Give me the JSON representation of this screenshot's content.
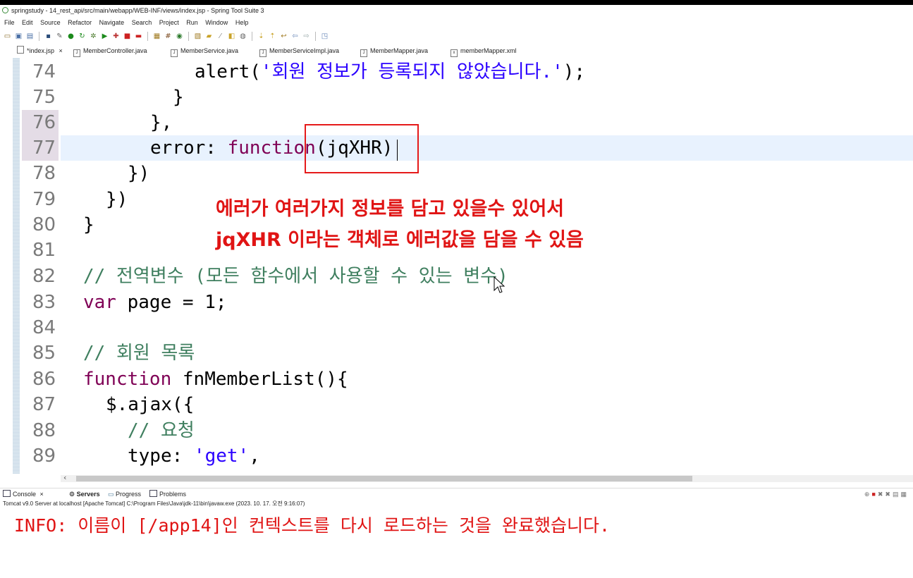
{
  "window": {
    "title": "springstudy - 14_rest_api/src/main/webapp/WEB-INF/views/index.jsp - Spring Tool Suite 3"
  },
  "menu": [
    "File",
    "Edit",
    "Source",
    "Refactor",
    "Navigate",
    "Search",
    "Project",
    "Run",
    "Window",
    "Help"
  ],
  "editor_tabs": [
    {
      "label": "*index.jsp",
      "close": "×"
    },
    {
      "label": "MemberController.java"
    },
    {
      "label": "MemberService.java"
    },
    {
      "label": "MemberServiceImpl.java"
    },
    {
      "label": "MemberMapper.java"
    },
    {
      "label": "memberMapper.xml"
    }
  ],
  "code_lines": [
    {
      "num": "74",
      "text": "alert('회원 정보가 등록되지 않았습니다.');"
    },
    {
      "num": "75",
      "text": "}"
    },
    {
      "num": "76",
      "text": "},"
    },
    {
      "num": "77",
      "text": "error: function(jqXHR)"
    },
    {
      "num": "78",
      "text": "})"
    },
    {
      "num": "79",
      "text": "})"
    },
    {
      "num": "80",
      "text": "}"
    },
    {
      "num": "81",
      "text": ""
    },
    {
      "num": "82",
      "text": "// 전역변수 (모든 함수에서 사용할 수 있는 변수)"
    },
    {
      "num": "83",
      "text": "var page = 1;"
    },
    {
      "num": "84",
      "text": ""
    },
    {
      "num": "85",
      "text": "// 회원 목록"
    },
    {
      "num": "86",
      "text": "function fnMemberList(){"
    },
    {
      "num": "87",
      "text": "$.ajax({"
    },
    {
      "num": "88",
      "text": "// 요청"
    },
    {
      "num": "89",
      "text": "type: 'get',"
    }
  ],
  "code_parts": {
    "l74_pre": "alert(",
    "l74_str": "'회원 정보가 등록되지 않았습니다.'",
    "l74_post": ");",
    "l77_pre": "error: ",
    "l77_kw": "function",
    "l77_post": "(jqXHR)",
    "l83_kw": "var",
    "l83_post": " page = 1;",
    "l86_kw": "function",
    "l86_post": " fnMemberList(){",
    "l89_pre": "type: ",
    "l89_str": "'get'",
    "l89_post": ","
  },
  "annotation": {
    "line1": "에러가 여러가지 정보를 담고 있을수 있어서",
    "line2": "jqXHR 이라는 객체로 에러값을 담을 수 있음"
  },
  "console_tabs": [
    {
      "label": "Console",
      "close": "×"
    },
    {
      "label": "Servers"
    },
    {
      "label": "Progress"
    },
    {
      "label": "Problems"
    }
  ],
  "console_info": "Tomcat v9.0 Server at localhost [Apache Tomcat] C:\\Program Files\\Java\\jdk-11\\bin\\javaw.exe  (2023. 10. 17. 오전 9:16:07)",
  "console_output": "INFO: 이름이 [/app14]인 컨텍스트를 다시 로드하는 것을 완료했습니다.",
  "colors": {
    "annotation": "#e01414",
    "keyword": "#7f0055",
    "string": "#2a00ff",
    "comment": "#3f7f5f",
    "current_line": "#e8f2fe"
  }
}
